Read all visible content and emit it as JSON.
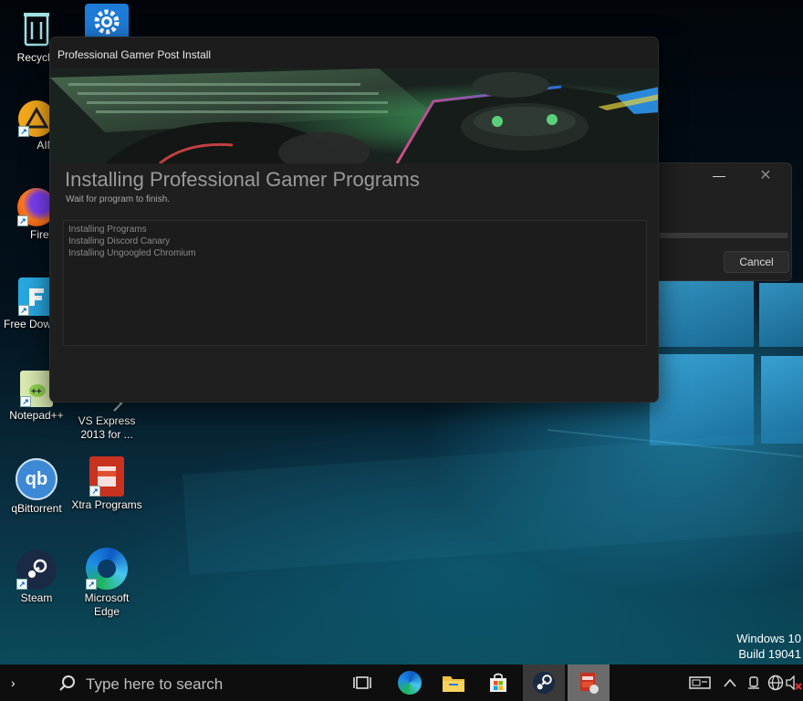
{
  "desktop": {
    "icons": [
      {
        "label": "Recycle",
        "icon": "recycle-bin-icon"
      },
      {
        "label": "",
        "icon": "settings-gear-icon"
      },
      {
        "label": "AIMP",
        "icon": "aimp-icon"
      },
      {
        "label": "Firefo:",
        "icon": "firefox-icon"
      },
      {
        "label": "Free Downlo",
        "icon": "free-download-manager-icon"
      },
      {
        "label": "Notepad++",
        "icon": "notepad-plus-plus-icon"
      },
      {
        "label": "VS Express 2013 for ...",
        "icon": "visual-studio-icon"
      },
      {
        "label": "qBittorrent",
        "icon": "qbittorrent-icon"
      },
      {
        "label": "Xtra Programs",
        "icon": "xtra-programs-icon"
      },
      {
        "label": "Steam",
        "icon": "steam-icon"
      },
      {
        "label": "Microsoft Edge",
        "icon": "edge-icon"
      }
    ],
    "watermark": {
      "line1": "Windows 10",
      "line2": "Build 19041"
    }
  },
  "back_dialog": {
    "minimize_glyph": "—",
    "close_glyph": "✕",
    "cancel_label": "Cancel"
  },
  "installer": {
    "title": "Professional Gamer Post Install",
    "heading": "Installing Professional Gamer Programs",
    "subheading": "Wait for program to finish.",
    "log": [
      "Installing Programs",
      "Installing Discord Canary",
      "Installing Ungoogled Chromium"
    ]
  },
  "taskbar": {
    "search_placeholder": "Type here to search",
    "start_glyph": "›",
    "apps": [
      "task-view-icon",
      "edge-icon",
      "file-explorer-icon",
      "store-icon",
      "steam-icon",
      "installer-icon"
    ]
  },
  "colors": {
    "dialog_bg": "#1f1f1f",
    "taskbar_bg": "#0e0e0e",
    "heading_text": "#9a9a9a"
  }
}
